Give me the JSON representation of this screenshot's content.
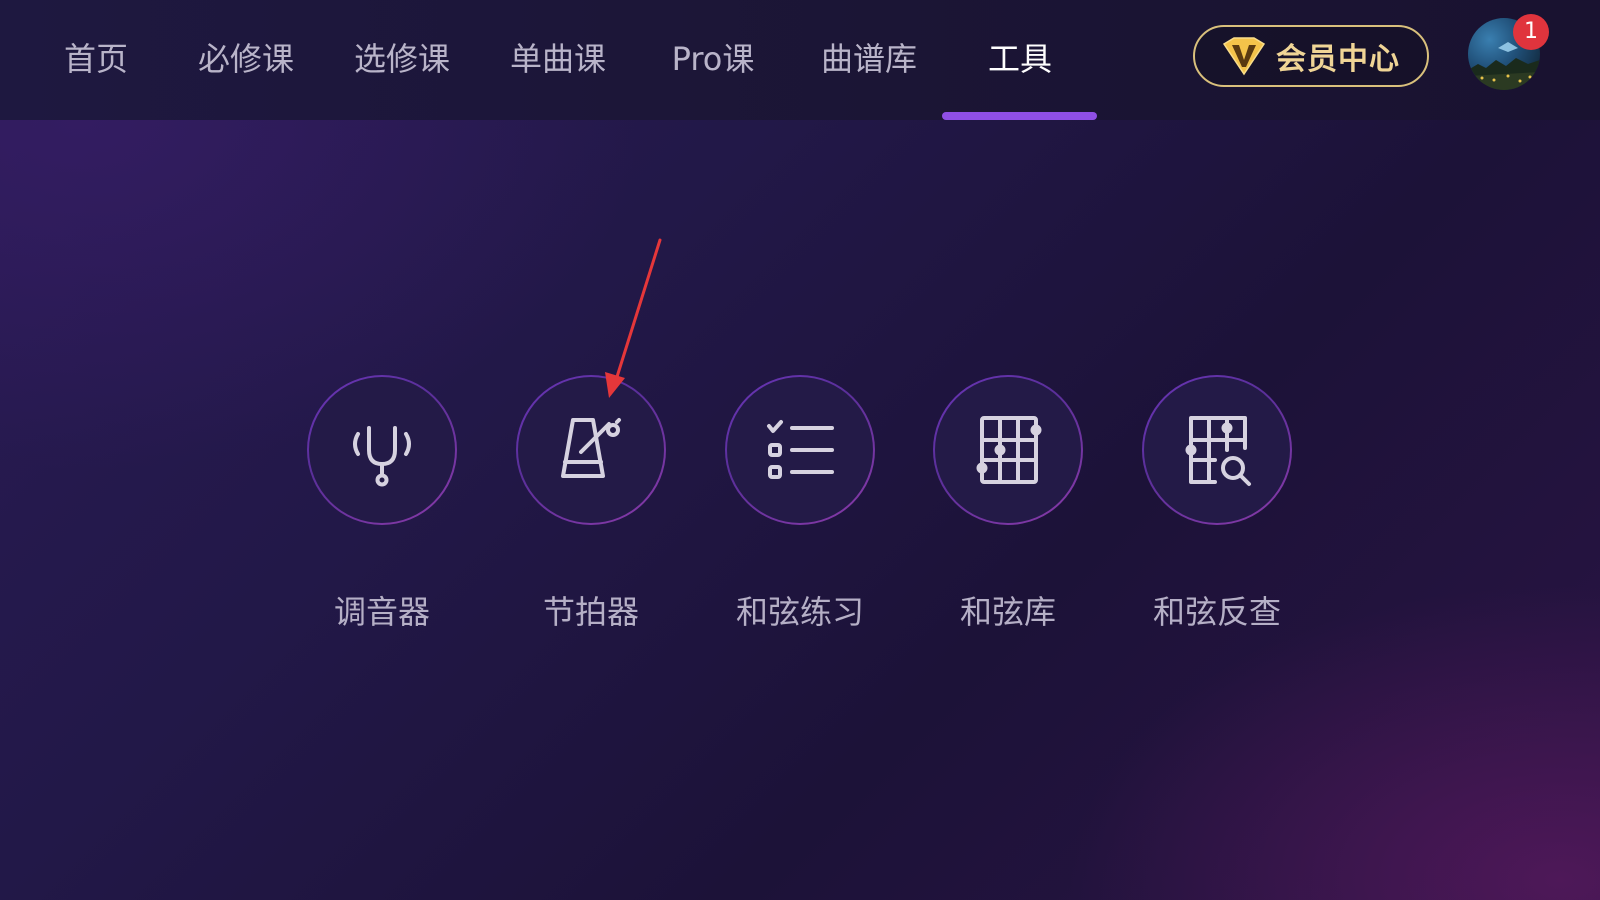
{
  "nav": {
    "items": [
      {
        "label": "首页"
      },
      {
        "label": "必修课"
      },
      {
        "label": "选修课"
      },
      {
        "label": "单曲课"
      },
      {
        "label": "Pro课"
      },
      {
        "label": "曲谱库"
      },
      {
        "label": "工具",
        "active": true
      }
    ]
  },
  "vip": {
    "label": "会员中心",
    "icon": "v-diamond-icon"
  },
  "avatar": {
    "notification_count": "1"
  },
  "tools": [
    {
      "label": "调音器",
      "icon": "tuning-fork-icon"
    },
    {
      "label": "节拍器",
      "icon": "metronome-icon"
    },
    {
      "label": "和弦练习",
      "icon": "checklist-icon"
    },
    {
      "label": "和弦库",
      "icon": "chord-grid-icon"
    },
    {
      "label": "和弦反查",
      "icon": "chord-search-icon"
    }
  ],
  "colors": {
    "accent": "#8f4fe6",
    "vip_gold": "#f0d596",
    "badge": "#e0343d",
    "annotation_arrow": "#e5373a"
  }
}
